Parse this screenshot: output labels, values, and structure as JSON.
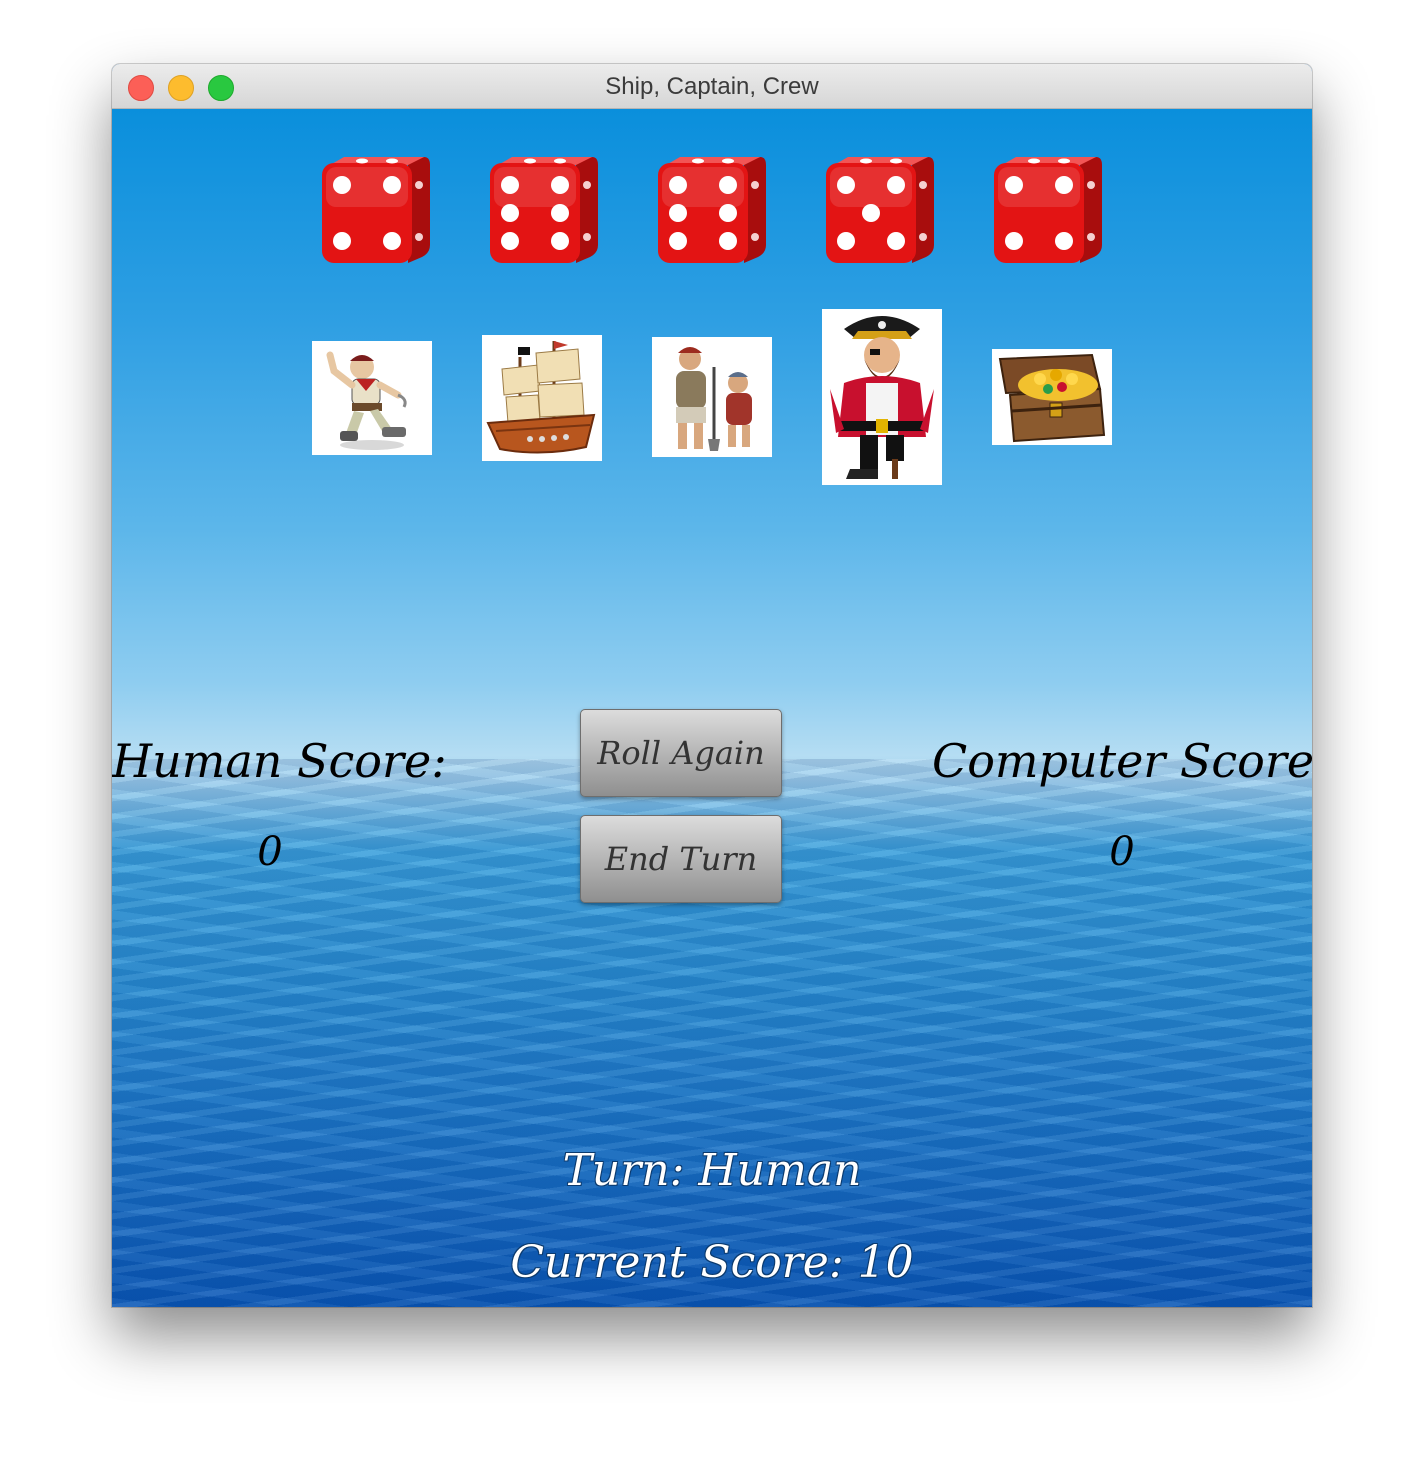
{
  "window": {
    "title": "Ship, Captain, Crew"
  },
  "dice": [
    {
      "name": "die-1",
      "face": 4
    },
    {
      "name": "die-2",
      "face": 6
    },
    {
      "name": "die-3",
      "face": 6
    },
    {
      "name": "die-4",
      "face": 5
    },
    {
      "name": "die-5",
      "face": 4
    }
  ],
  "pieces": [
    "crew-pirate-icon",
    "ship-icon",
    "crew-pair-icon",
    "captain-icon",
    "treasure-chest-icon"
  ],
  "scores": {
    "human_label": "Human Score:",
    "human_value": "0",
    "computer_label": "Computer Score:",
    "computer_value": "0"
  },
  "buttons": {
    "roll_again": "Roll Again",
    "end_turn": "End Turn"
  },
  "status": {
    "turn": "Turn: Human",
    "current_score": "Current Score: 10"
  },
  "colors": {
    "die_red": "#e31414",
    "pip": "#ffffff",
    "sea_top": "#0a8fdc",
    "sea_bottom": "#0a57b6"
  }
}
